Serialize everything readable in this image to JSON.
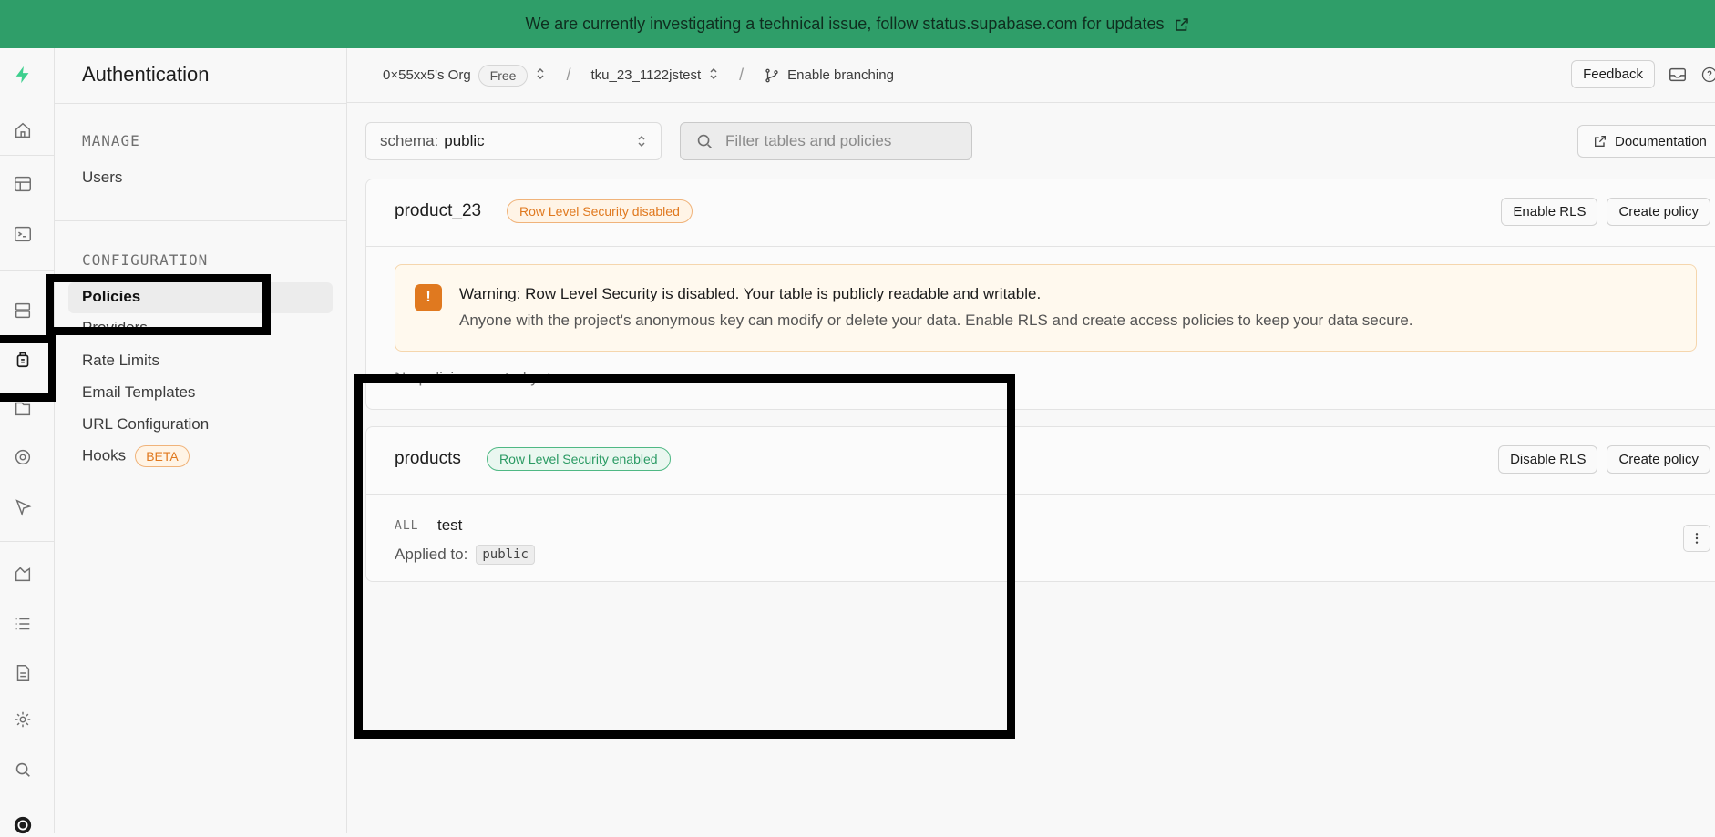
{
  "banner": {
    "text": "We are currently investigating a technical issue, follow status.supabase.com for updates"
  },
  "sidepanel": {
    "title": "Authentication",
    "sections": [
      {
        "heading": "MANAGE",
        "items": [
          "Users"
        ]
      },
      {
        "heading": "CONFIGURATION",
        "items": [
          "Policies",
          "Providers",
          "Rate Limits",
          "Email Templates",
          "URL Configuration",
          "Hooks"
        ]
      }
    ],
    "active_item": "Policies",
    "hooks_badge": "BETA"
  },
  "topbar": {
    "org": "0×55xx5's Org",
    "plan": "Free",
    "project": "tku_23_1122jstest",
    "branching": "Enable branching",
    "feedback": "Feedback"
  },
  "toolbar": {
    "schema_label": "schema:",
    "schema_value": "public",
    "filter_placeholder": "Filter tables and policies",
    "documentation": "Documentation"
  },
  "tables": [
    {
      "name": "product_23",
      "rls_status": "Row Level Security disabled",
      "toggle_label": "Enable RLS",
      "create_label": "Create policy",
      "warning_title": "Warning: Row Level Security is disabled. Your table is publicly readable and writable.",
      "warning_body": "Anyone with the project's anonymous key can modify or delete your data. Enable RLS and create access policies to keep your data secure.",
      "empty_text": "No policies created yet"
    },
    {
      "name": "products",
      "rls_status": "Row Level Security enabled",
      "toggle_label": "Disable RLS",
      "create_label": "Create policy",
      "policies": [
        {
          "command": "ALL",
          "name": "test",
          "applied_label": "Applied to:",
          "role": "public"
        }
      ]
    }
  ],
  "colors": {
    "banner": "#2f9e69",
    "warning_accent": "#e0791f",
    "enabled_badge": "#2a9a63"
  }
}
